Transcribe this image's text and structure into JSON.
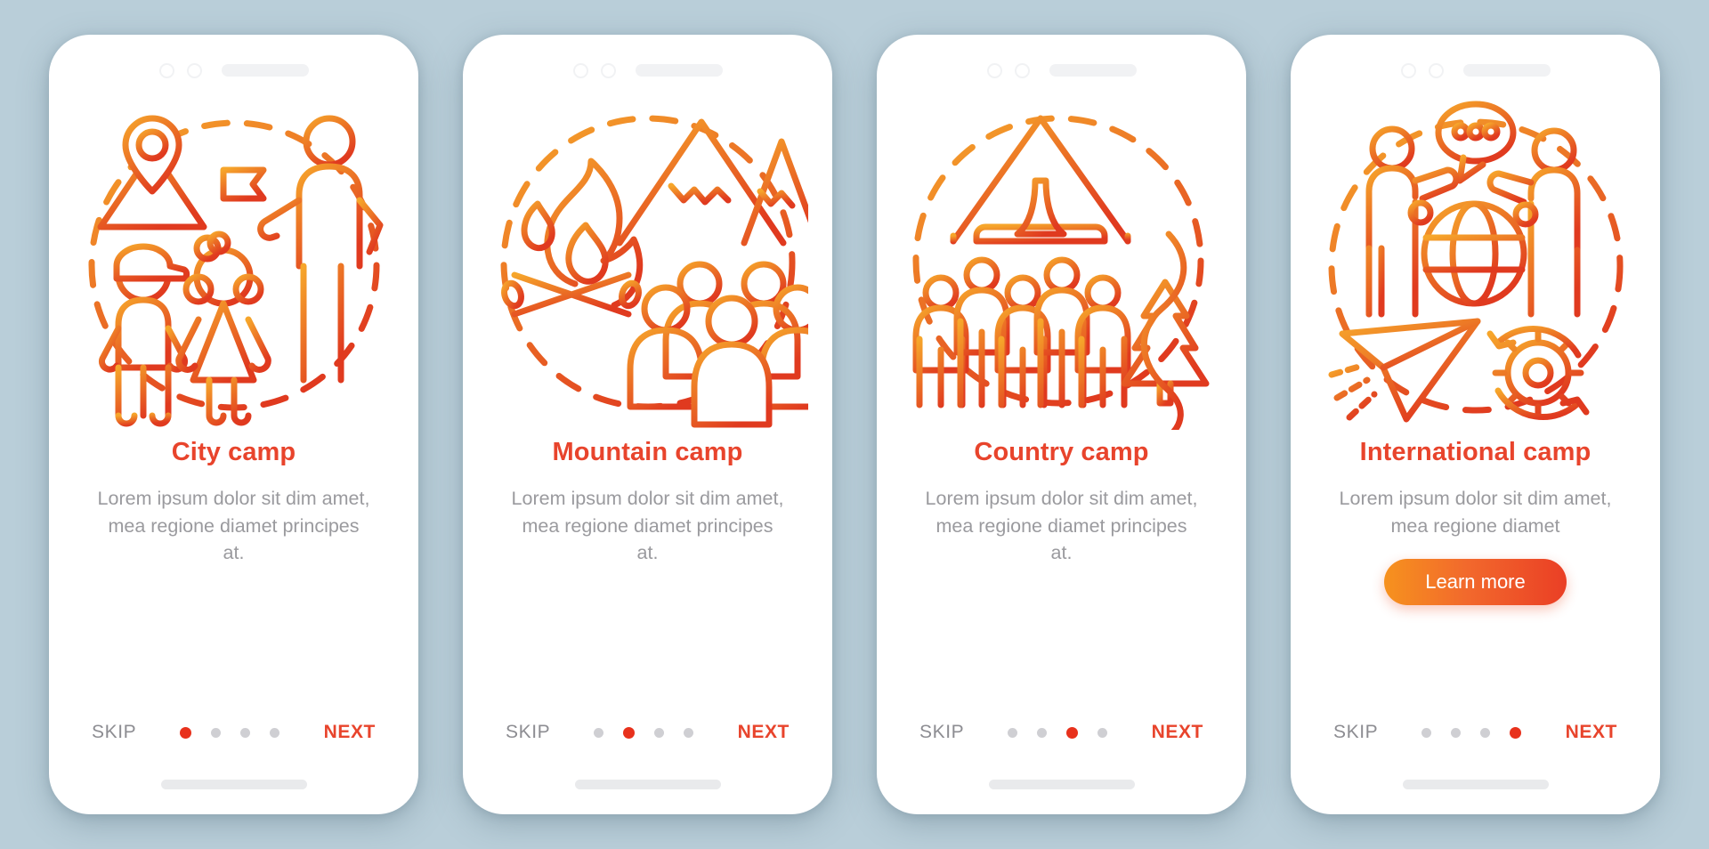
{
  "background_color": "#b9ced9",
  "theme": {
    "accent": "#e8442c",
    "accent_dot": "#e8311c",
    "muted_text": "#9a9a9e",
    "skip_text": "#8d8d92",
    "button_gradient_from": "#f6921e",
    "button_gradient_to": "#ea3f25",
    "illustration_gradient_from": "#f6a62b",
    "illustration_gradient_to": "#e03a1f"
  },
  "statusbar": {
    "icons": [
      "circle-outline-icon",
      "circle-outline-icon",
      "status-bar-pill"
    ]
  },
  "footer_labels": {
    "skip": "SKIP",
    "next": "NEXT"
  },
  "screens": [
    {
      "id": "city-camp",
      "illustration": "city-camp-illustration",
      "title": "City camp",
      "description": "Lorem ipsum dolor sit dim amet, mea regione diamet principes at.",
      "dots": 4,
      "active_dot": 1,
      "has_learn_more": false
    },
    {
      "id": "mountain-camp",
      "illustration": "mountain-camp-illustration",
      "title": "Mountain camp",
      "description": "Lorem ipsum dolor sit dim amet, mea regione diamet principes at.",
      "dots": 4,
      "active_dot": 2,
      "has_learn_more": false
    },
    {
      "id": "country-camp",
      "illustration": "country-camp-illustration",
      "title": "Country camp",
      "description": "Lorem ipsum dolor sit dim amet, mea regione diamet principes at.",
      "dots": 4,
      "active_dot": 3,
      "has_learn_more": false
    },
    {
      "id": "international-camp",
      "illustration": "international-camp-illustration",
      "title": "International camp",
      "description": "Lorem ipsum dolor sit dim amet, mea regione diamet",
      "dots": 4,
      "active_dot": 4,
      "has_learn_more": true,
      "learn_more_label": "Learn more"
    }
  ]
}
